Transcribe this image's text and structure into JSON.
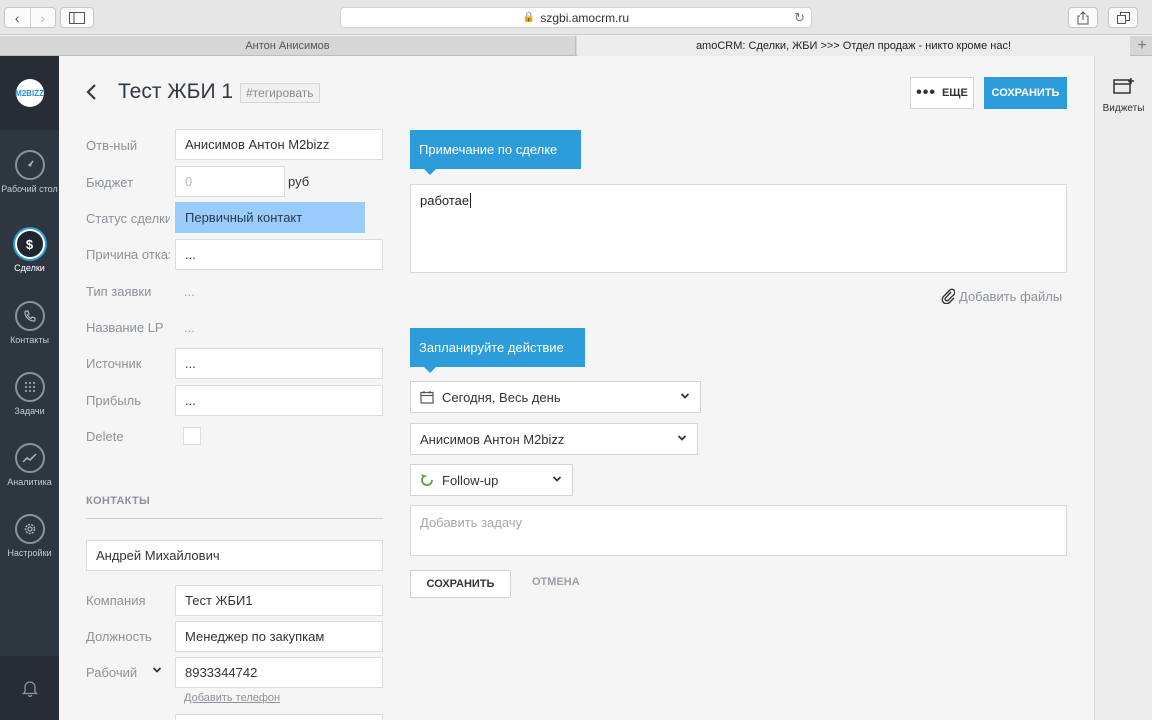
{
  "browser": {
    "url": "szgbi.amocrm.ru",
    "tabs": [
      {
        "label": "Антон Анисимов"
      },
      {
        "label": "amoCRM: Сделки, ЖБИ >>> Отдел продаж - никто кроме нас!"
      }
    ]
  },
  "sidebar": {
    "logo": "M2BIZZ",
    "items": [
      {
        "label": "Рабочий стол",
        "icon": "dashboard-icon"
      },
      {
        "label": "Сделки",
        "icon": "dollar-icon",
        "active": true
      },
      {
        "label": "Контакты",
        "icon": "phone-icon"
      },
      {
        "label": "Задачи",
        "icon": "calendar-icon"
      },
      {
        "label": "Аналитика",
        "icon": "analytics-icon"
      },
      {
        "label": "Настройки",
        "icon": "gear-icon"
      }
    ]
  },
  "widgets": {
    "label": "Виджеты"
  },
  "header": {
    "title": "Тест ЖБИ 1",
    "tag_placeholder": "#тегировать",
    "more_label": "ЕЩЕ",
    "save_label": "СОХРАНИТЬ"
  },
  "fields": {
    "responsible": {
      "label": "Отв-ный",
      "value": "Анисимов Антон M2bizz"
    },
    "budget": {
      "label": "Бюджет",
      "placeholder": "0",
      "unit": "руб"
    },
    "status": {
      "label": "Статус сделки",
      "value": "Первичный контакт"
    },
    "reject_reason": {
      "label": "Причина отказа",
      "value": "..."
    },
    "request_type": {
      "label": "Тип заявки",
      "value": "..."
    },
    "lp_name": {
      "label": "Название LP",
      "value": "..."
    },
    "source": {
      "label": "Источник",
      "value": "..."
    },
    "profit": {
      "label": "Прибыль",
      "value": "..."
    },
    "delete": {
      "label": "Delete"
    }
  },
  "contacts": {
    "header": "КОНТАКТЫ",
    "name": "Андрей Михайлович",
    "company": {
      "label": "Компания",
      "value": "Тест ЖБИ1"
    },
    "position": {
      "label": "Должность",
      "value": "Менеджер по закупкам"
    },
    "phone": {
      "label": "Рабочий",
      "value": "8933344742"
    },
    "add_phone": "Добавить телефон"
  },
  "note": {
    "tab": "Примечание по сделке",
    "text": "работае",
    "add_files": "Добавить файлы"
  },
  "plan": {
    "tab": "Запланируйте действие",
    "date": "Сегодня, Весь день",
    "assignee": "Анисимов Антон M2bizz",
    "type": "Follow-up",
    "task_placeholder": "Добавить задачу",
    "save_label": "СОХРАНИТЬ",
    "cancel_label": "ОТМЕНА"
  },
  "colors": {
    "accent": "#2d9cdb",
    "status_bg": "#99ccfd",
    "sidebar_bg": "#2e3640"
  }
}
